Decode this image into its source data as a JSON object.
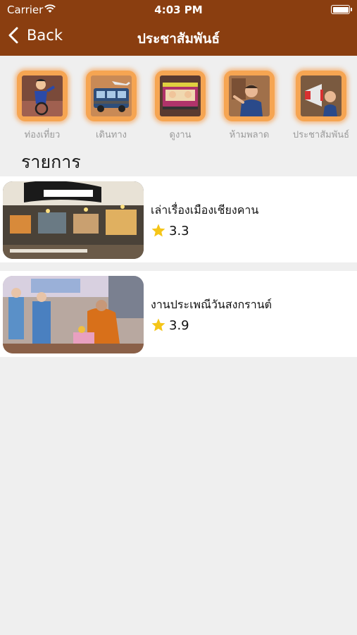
{
  "status_bar": {
    "carrier": "Carrier",
    "time": "4:03 PM"
  },
  "nav": {
    "back_label": "Back",
    "title": "ประชาสัมพันธ์"
  },
  "categories": [
    {
      "label": "ท่องเที่ยว",
      "icon": "cyclist-icon"
    },
    {
      "label": "เดินทาง",
      "icon": "bus-airplane-icon"
    },
    {
      "label": "ดูงาน",
      "icon": "tram-people-icon"
    },
    {
      "label": "ห้ามพลาด",
      "icon": "man-pointing-icon"
    },
    {
      "label": "ประชาสัมพันธ์",
      "icon": "megaphone-icon"
    }
  ],
  "section_title": "รายการ",
  "items": [
    {
      "title": "เล่าเรื่องเมืองเชียงคาน",
      "rating": "3.3"
    },
    {
      "title": "งานประเพณีวันสงกรานต์",
      "rating": "3.9"
    }
  ],
  "colors": {
    "nav_bar": "#8a3e10",
    "tile": "#f6a552",
    "background": "#efefef",
    "star": "#f5c518"
  }
}
